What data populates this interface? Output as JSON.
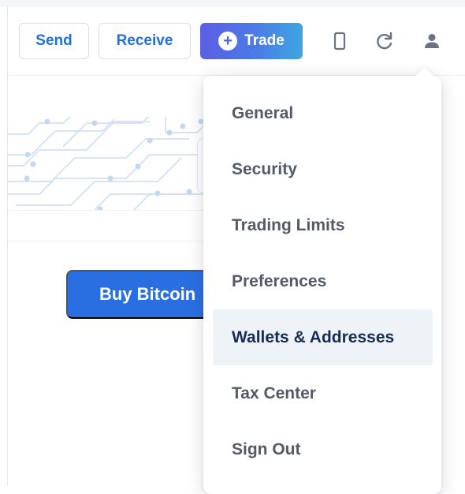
{
  "toolbar": {
    "send_label": "Send",
    "receive_label": "Receive",
    "trade_label": "Trade"
  },
  "icons": {
    "trade": "plus-circle-icon",
    "device": "mobile-phone-icon",
    "refresh": "refresh-icon",
    "account": "user-icon"
  },
  "main": {
    "buy_label": "Buy Bitcoin"
  },
  "account_menu": {
    "items": [
      {
        "label": "General"
      },
      {
        "label": "Security"
      },
      {
        "label": "Trading Limits"
      },
      {
        "label": "Preferences"
      },
      {
        "label": "Wallets & Addresses",
        "active": true
      },
      {
        "label": "Tax Center"
      },
      {
        "label": "Sign Out"
      }
    ]
  },
  "colors": {
    "link_blue": "#1f6fdc",
    "buy_button": "#2a6fe1",
    "trade_gradient_start": "#5b5ee3",
    "trade_gradient_end": "#3ea6e0",
    "menu_text": "#545a66",
    "menu_active_text": "#182c55",
    "menu_active_bg": "#eef3f8"
  }
}
